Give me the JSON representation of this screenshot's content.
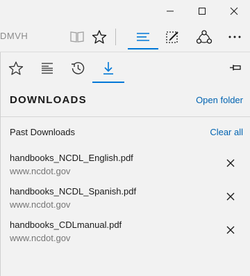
{
  "window": {
    "controls": [
      "minimize-icon",
      "maximize-icon",
      "close-icon"
    ]
  },
  "toolbar": {
    "address_text": "DMVH",
    "icons": [
      "reading-view-icon",
      "favorite-star-icon",
      "hub-icon",
      "web-note-icon",
      "share-icon",
      "more-icon"
    ],
    "accent": "#0078d7"
  },
  "hub": {
    "tabs": [
      {
        "icon": "favorites-star-icon"
      },
      {
        "icon": "reading-list-icon"
      },
      {
        "icon": "history-icon"
      },
      {
        "icon": "downloads-icon",
        "active": true
      }
    ],
    "pin_icon": "pin-icon"
  },
  "downloads": {
    "title": "DOWNLOADS",
    "open_folder": "Open folder",
    "section_label": "Past Downloads",
    "clear_all": "Clear all",
    "items": [
      {
        "name": "handbooks_NCDL_English.pdf",
        "source": "www.ncdot.gov"
      },
      {
        "name": "handbooks_NCDL_Spanish.pdf",
        "source": "www.ncdot.gov"
      },
      {
        "name": "handbooks_CDLmanual.pdf",
        "source": "www.ncdot.gov"
      }
    ],
    "link_color": "#0063b1"
  }
}
